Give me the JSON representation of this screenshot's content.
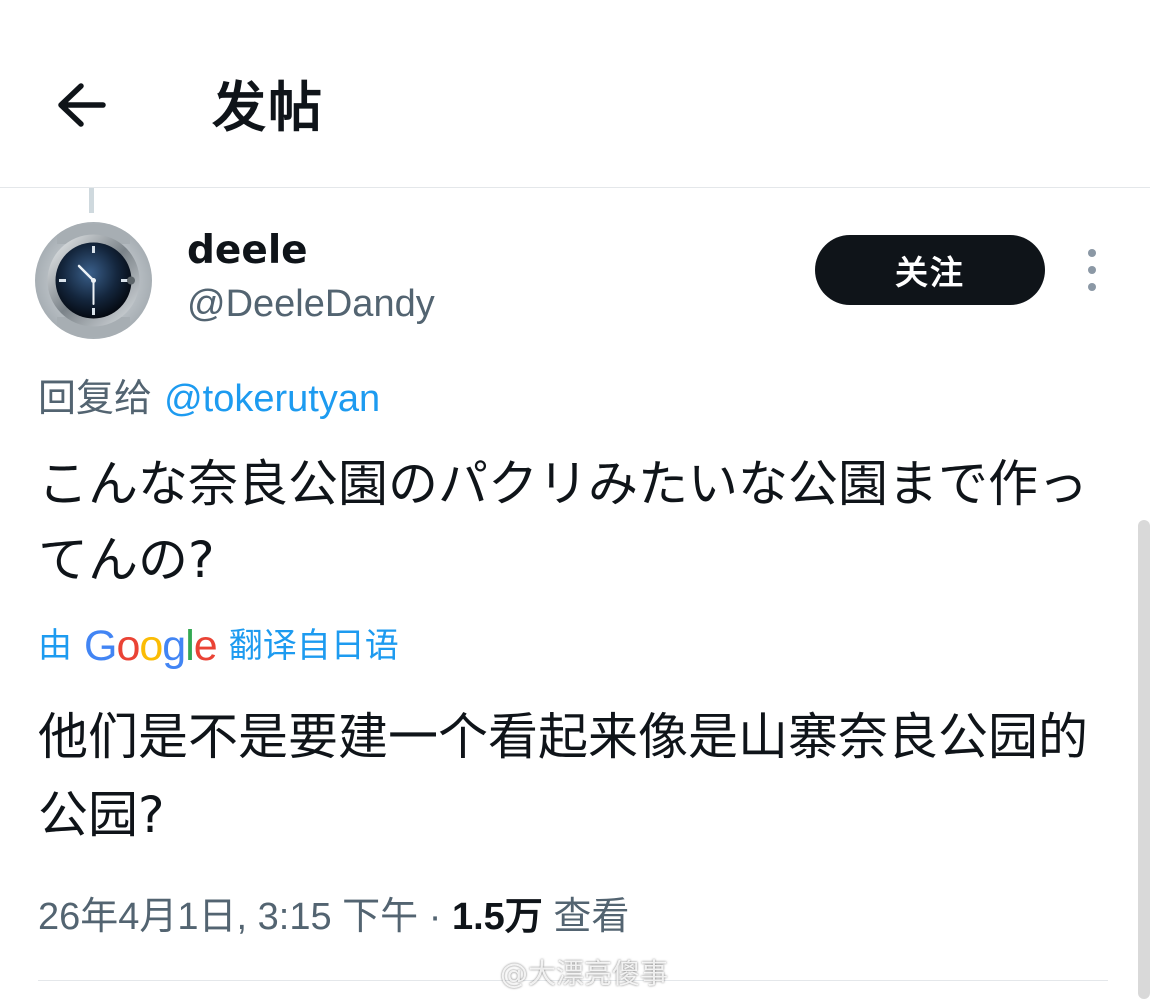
{
  "header": {
    "title": "发帖",
    "back_icon": "arrow-left-icon"
  },
  "post": {
    "display_name": "deele",
    "handle": "@DeeleDandy",
    "follow_label": "关注",
    "more_icon": "more-vertical-icon",
    "reply_prefix": "回复给",
    "reply_to": "@tokerutyan",
    "original_text": "こんな奈良公園のパクリみたいな公園まで作ってんの?",
    "translate_prefix": "由",
    "translate_brand": "Google",
    "translate_suffix": "翻译自日语",
    "translated_text": "他们是不是要建一个看起来像是山寨奈良公园的公园?",
    "timestamp": "26年4月1日, 3:15 下午",
    "separator": "·",
    "views_count": "1.5万",
    "views_label": "查看"
  },
  "watermark": "@大漂亮傻事",
  "colors": {
    "accent": "#1d9bf0",
    "follow_bg": "#0f1419",
    "secondary_text": "#536471"
  }
}
